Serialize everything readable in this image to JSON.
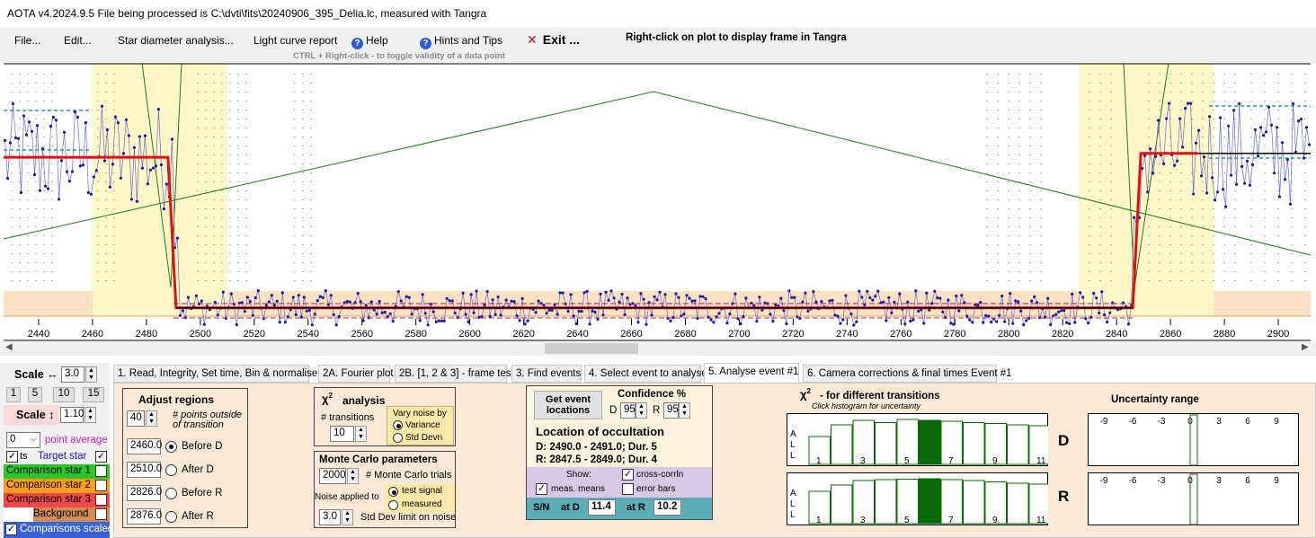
{
  "window": {
    "title": "AOTA v4.2024.9.5    File being processed is C:\\dvti\\fits\\20240906_395_Delia.lc, measured with Tangra"
  },
  "menu": {
    "file": "File...",
    "edit": "Edit...",
    "star_diameter": "Star diameter analysis...",
    "light_curve_report": "Light curve report",
    "help": "Help",
    "hints": "Hints and Tips",
    "exit": "Exit ...",
    "right_click_hint": "Right-click on plot to display frame in Tangra",
    "ctrl_hint": "CTRL + Right-click  -  to toggle validity of a data point"
  },
  "plot": {
    "x_ticks": [
      "2440",
      "2460",
      "2480",
      "2500",
      "2520",
      "2540",
      "2560",
      "2580",
      "2600",
      "2620",
      "2640",
      "2660",
      "2680",
      "2700",
      "2720",
      "2740",
      "2760",
      "2780",
      "2800",
      "2820",
      "2840",
      "2860",
      "2880",
      "2900"
    ],
    "colors": {
      "data": "#1a1aa0",
      "fit": "#e01010",
      "model": "#1e7a1e",
      "region": "#fff7c8",
      "baseline": "#f9e1c2"
    }
  },
  "left_panel": {
    "scale_h_label": "Scale ↔",
    "scale_h_value": "3.0",
    "scale_buttons": [
      "1",
      "5",
      "10",
      "15"
    ],
    "scale_v_label": "Scale ↕",
    "scale_v_value": "1.10",
    "point_avg_value": "0",
    "point_avg_label": "point average",
    "pts_label": "ts",
    "target_label": "Target star",
    "comp1": "Comparison star 1",
    "comp2": "Comparison star 2",
    "comp3": "Comparison star 3",
    "background": "Background",
    "comp_scaled": "Comparisons scaled"
  },
  "tabs": [
    {
      "label": "1.  Read, Integrity, Set time, Bin & normalise"
    },
    {
      "label": "2A. Fourier plot"
    },
    {
      "label": "2B. [1, 2 & 3] - frame test"
    },
    {
      "label": "3. Find events"
    },
    {
      "label": "4. Select event to analyse"
    },
    {
      "label": "5. Analyse event #1"
    },
    {
      "label": "6. Camera corrections & final times Event #1"
    }
  ],
  "adjust": {
    "title": "Adjust regions",
    "points_value": "40",
    "points_label": "# points outside of transition",
    "before_d_value": "2460.0",
    "before_d": "Before D",
    "after_d_value": "2510.0",
    "after_d": "After D",
    "before_r_value": "2826.0",
    "before_r": "Before R",
    "after_r_value": "2876.0",
    "after_r": "After R"
  },
  "chi": {
    "title": "analysis",
    "transitions_label": "# transitions",
    "transitions_value": "10",
    "vary_label": "Vary noise by",
    "variance": "Variance",
    "std_devn": "Std Devn"
  },
  "monte": {
    "title": "Monte Carlo parameters",
    "trials_value": "2000",
    "trials_label": "# Monte Carlo trials",
    "noise_applied": "Noise applied to",
    "test_signal": "test signal",
    "measured": "measured",
    "std_limit_value": "3.0",
    "std_limit_label": "Std Dev limit on noise"
  },
  "location": {
    "get_event": "Get event locations",
    "confidence_label": "Confidence %",
    "d_label": "D",
    "d_value": "95",
    "r_label": "R",
    "r_value": "95",
    "title": "Location of occultation",
    "d_line": "D: 2490.0 - 2491.0; Dur. 5",
    "r_line": "R: 2847.5 - 2849.0; Dur. 4",
    "show_label": "Show:",
    "cross_corr": "cross-corrln",
    "meas_means": "meas. means",
    "error_bars": "error bars",
    "sn_label": "S/N",
    "at_d_label": "at D",
    "at_d_value": "11.4",
    "at_r_label": "at R",
    "at_r_value": "10.2"
  },
  "transitions": {
    "title": "- for different transitions",
    "subtitle": "Click histogram for uncertainty",
    "all": "A L L",
    "d_label": "D",
    "r_label": "R",
    "x_labels": [
      "1",
      "3",
      "5",
      "7",
      "9",
      "11"
    ],
    "d_heights": [
      0.62,
      0.88,
      0.98,
      0.93,
      1.0,
      0.98,
      0.96,
      0.93,
      0.91,
      0.88,
      0.86
    ],
    "d_selected": 5,
    "r_heights": [
      0.72,
      0.86,
      0.96,
      0.98,
      0.99,
      1.0,
      0.98,
      0.96,
      0.93,
      0.9,
      0.88
    ],
    "r_selected": 5
  },
  "uncertainty": {
    "title": "Uncertainty range",
    "labels": [
      "-9",
      "-6",
      "-3",
      "0",
      "3",
      "6",
      "9"
    ]
  }
}
